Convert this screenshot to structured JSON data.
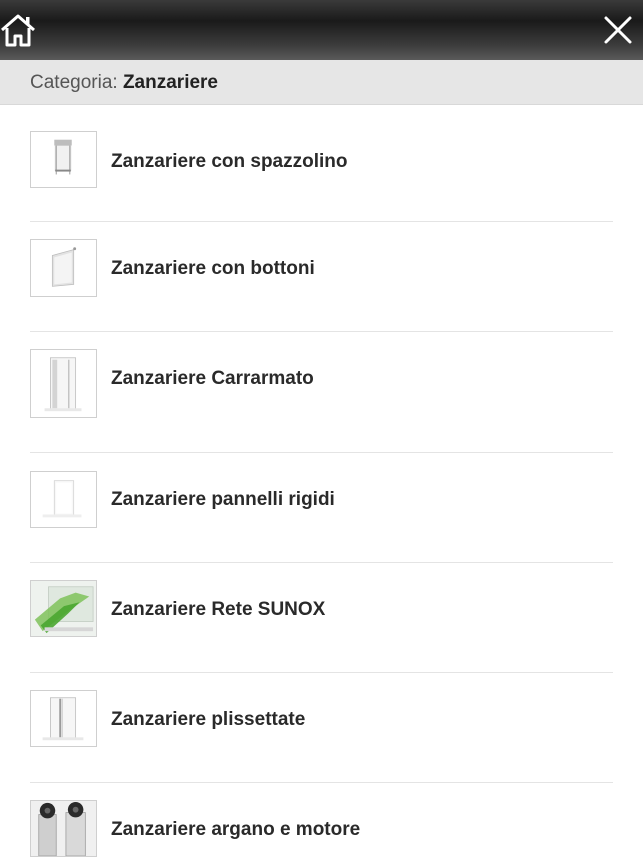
{
  "header": {
    "home_icon": "home-icon",
    "close_icon": "close-icon"
  },
  "category": {
    "prefix": "Categoria:",
    "value": "Zanzariere"
  },
  "items": [
    {
      "label": "Zanzariere con spazzolino",
      "icon": "roller-screen-thumbnail"
    },
    {
      "label": "Zanzariere con bottoni",
      "icon": "button-screen-thumbnail"
    },
    {
      "label": "Zanzariere Carrarmato",
      "icon": "door-screen-thumbnail"
    },
    {
      "label": "Zanzariere pannelli rigidi",
      "icon": "rigid-panel-thumbnail"
    },
    {
      "label": "Zanzariere Rete SUNOX",
      "icon": "sunox-net-thumbnail"
    },
    {
      "label": "Zanzariere plissettate",
      "icon": "pleated-screen-thumbnail"
    },
    {
      "label": "Zanzariere argano e motore",
      "icon": "winch-motor-thumbnail"
    }
  ]
}
